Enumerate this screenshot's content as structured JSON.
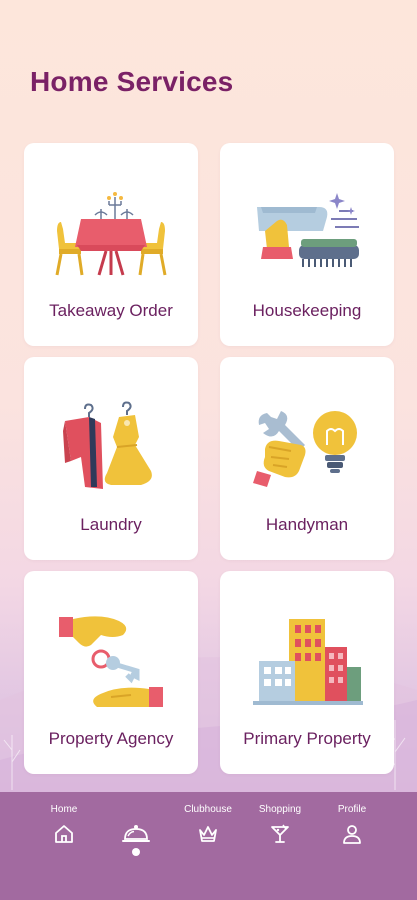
{
  "page": {
    "title": "Home Services"
  },
  "services": [
    {
      "label": "Takeaway Order",
      "icon": "dining-table-icon"
    },
    {
      "label": "Housekeeping",
      "icon": "cleaning-icon"
    },
    {
      "label": "Laundry",
      "icon": "clothes-icon"
    },
    {
      "label": "Handyman",
      "icon": "wrench-bulb-icon"
    },
    {
      "label": "Property Agency",
      "icon": "key-handover-icon"
    },
    {
      "label": "Primary Property",
      "icon": "buildings-icon"
    }
  ],
  "nav": {
    "items": [
      {
        "label": "Home",
        "icon": "home-icon"
      },
      {
        "label": "",
        "icon": "service-bell-icon",
        "active": true
      },
      {
        "label": "Clubhouse",
        "icon": "crown-icon"
      },
      {
        "label": "Shopping",
        "icon": "cocktail-icon"
      },
      {
        "label": "Profile",
        "icon": "person-icon"
      }
    ]
  },
  "colors": {
    "title": "#7a2166",
    "nav_bg": "#a26aa0",
    "card_bg": "#ffffff"
  }
}
